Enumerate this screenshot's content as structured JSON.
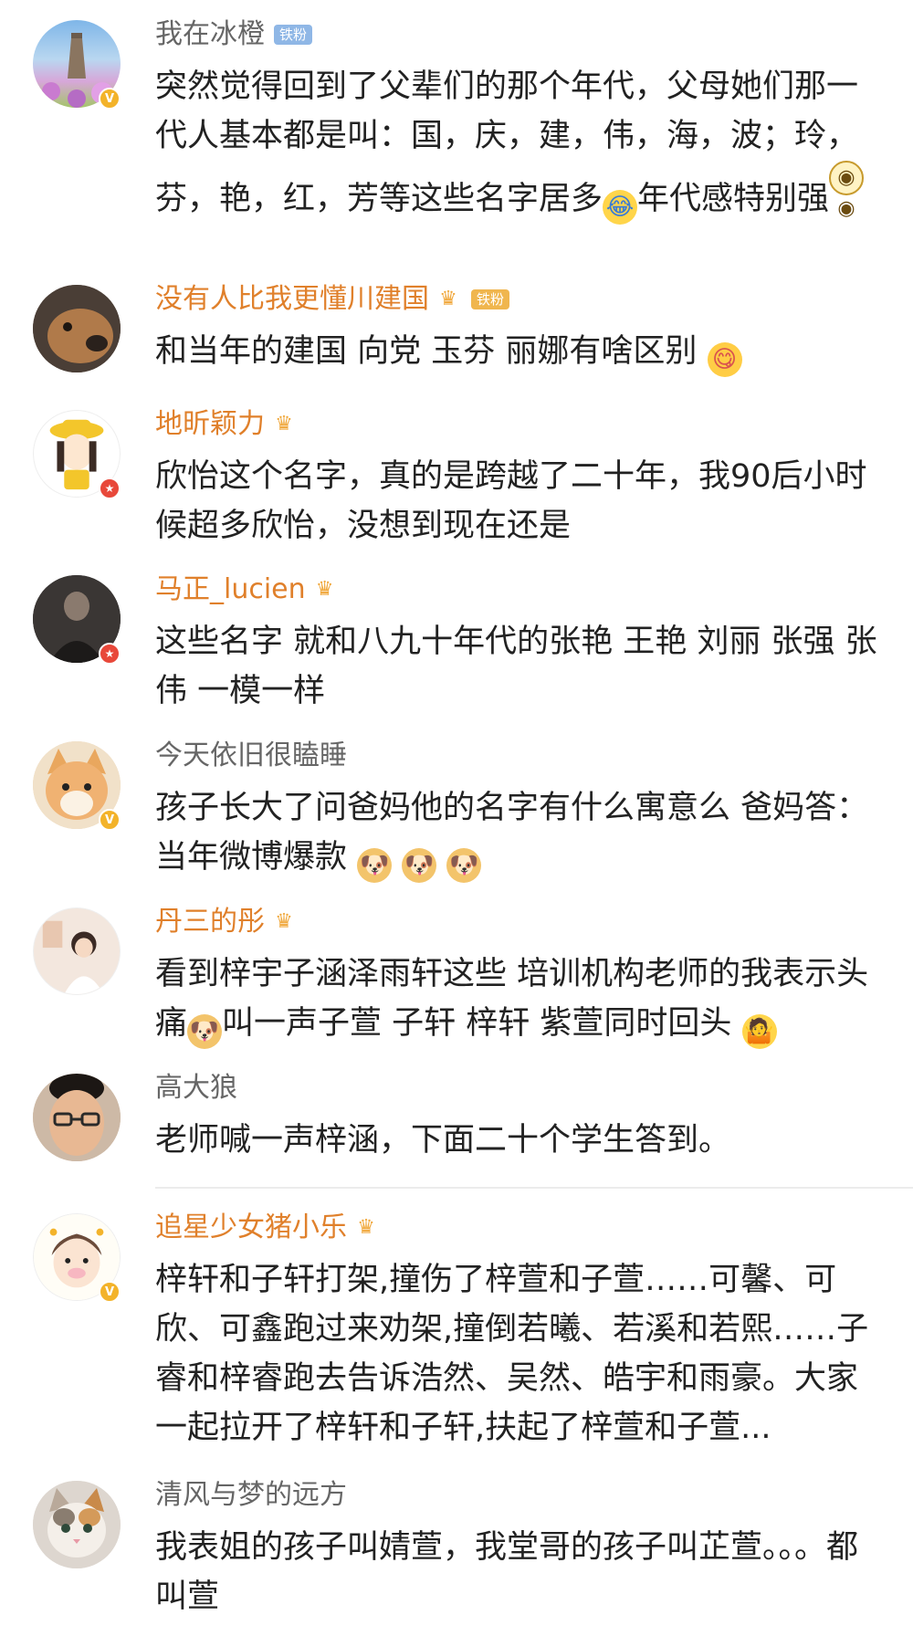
{
  "comments": [
    {
      "name": "我在冰橙",
      "badge": "铁粉",
      "text_parts": [
        "突然觉得回到了父辈们的那个年代，父母她们那一代人基本都是叫：国，庆，建，伟，海，波；玲，芬，艳，红，芳等这些名字居多",
        "年代感特别强",
        ""
      ],
      "emojis": [
        "laugh-cry-emoji",
        "glasses-emoji"
      ]
    },
    {
      "name": "没有人比我更懂川建国",
      "badge": "铁粉",
      "text_parts": [
        "和当年的建国 向党 玉芬 丽娜有啥区别"
      ],
      "emojis": [
        "yum-emoji"
      ]
    },
    {
      "name": "地昕颖力",
      "text_parts": [
        "欣怡这个名字，真的是跨越了二十年，我90后小时候超多欣怡，没想到现在还是"
      ]
    },
    {
      "name": "马正_lucien",
      "text_parts": [
        "这些名字 就和八九十年代的张艳 王艳 刘丽 张强 张伟 一模一样"
      ]
    },
    {
      "name": "今天依旧很瞌睡",
      "text_parts": [
        "孩子长大了问爸妈他的名字有什么寓意么   爸妈答：当年微博爆款"
      ],
      "emojis": [
        "doge-emoji",
        "doge-emoji",
        "doge-emoji"
      ]
    },
    {
      "name": "丹三的彤",
      "text_parts": [
        "看到梓宇子涵泽雨轩这些 培训机构老师的我表示头痛",
        "叫一声子萱 子轩 梓轩 紫萱同时回头"
      ],
      "emojis": [
        "doge-emoji",
        "shrug-emoji"
      ]
    },
    {
      "name": "高大狼",
      "text_parts": [
        "老师喊一声梓涵，下面二十个学生答到。"
      ]
    },
    {
      "name": "追星少女猪小乐",
      "text_parts": [
        "梓轩和子轩打架,撞伤了梓萱和子萱……可馨、可欣、可鑫跑过来劝架,撞倒若曦、若溪和若熙……子睿和梓睿跑去告诉浩然、吴然、皓宇和雨豪。大家一起拉开了梓轩和子轩,扶起了梓萱和子萱..."
      ]
    },
    {
      "name": "清风与梦的远方",
      "text_parts": [
        "我表姐的孩子叫婧萱，我堂哥的孩子叫芷萱。。。都叫萱"
      ]
    }
  ],
  "glyphs": {
    "verified": "V",
    "star": "★",
    "crown": "♛",
    "laugh": "😂",
    "glasses": "◉◉",
    "yum": "😋",
    "doge": "🐶",
    "shrug": "🤷"
  },
  "colors": {
    "name_orange": "#e0802b",
    "name_gray": "#666666",
    "verified_gold": "#f3b32a",
    "star_red": "#e8483a",
    "fan_badge_blue": "#8fb7e6",
    "fan_badge_gold": "#f0b64e"
  }
}
